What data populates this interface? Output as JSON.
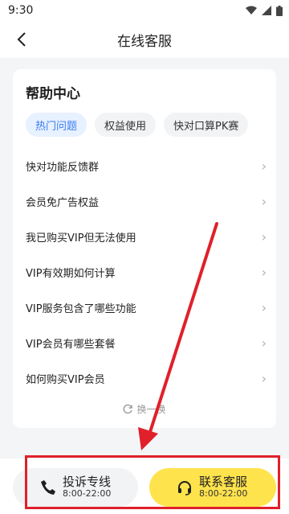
{
  "status_bar": {
    "time": "9:30"
  },
  "header": {
    "title": "在线客服"
  },
  "help_center": {
    "title": "帮助中心",
    "tabs": [
      {
        "label": "热门问题",
        "active": true
      },
      {
        "label": "权益使用",
        "active": false
      },
      {
        "label": "快对口算PK赛",
        "active": false
      }
    ],
    "questions": [
      "快对功能反馈群",
      "会员免广告权益",
      "我已购买VIP但无法使用",
      "VIP有效期如何计算",
      "VIP服务包含了哪些功能",
      "VIP会员有哪些套餐",
      "如何购买VIP会员"
    ],
    "refresh_label": "换一换"
  },
  "bottom": {
    "complaint": {
      "label": "投诉专线",
      "hours": "8:00-22:00"
    },
    "contact": {
      "label": "联系客服",
      "hours": "8:00-22:00"
    }
  },
  "colors": {
    "accent_blue": "#3a7cf3",
    "contact_yellow": "#ffe34d",
    "annotation_red": "#e0202a"
  }
}
